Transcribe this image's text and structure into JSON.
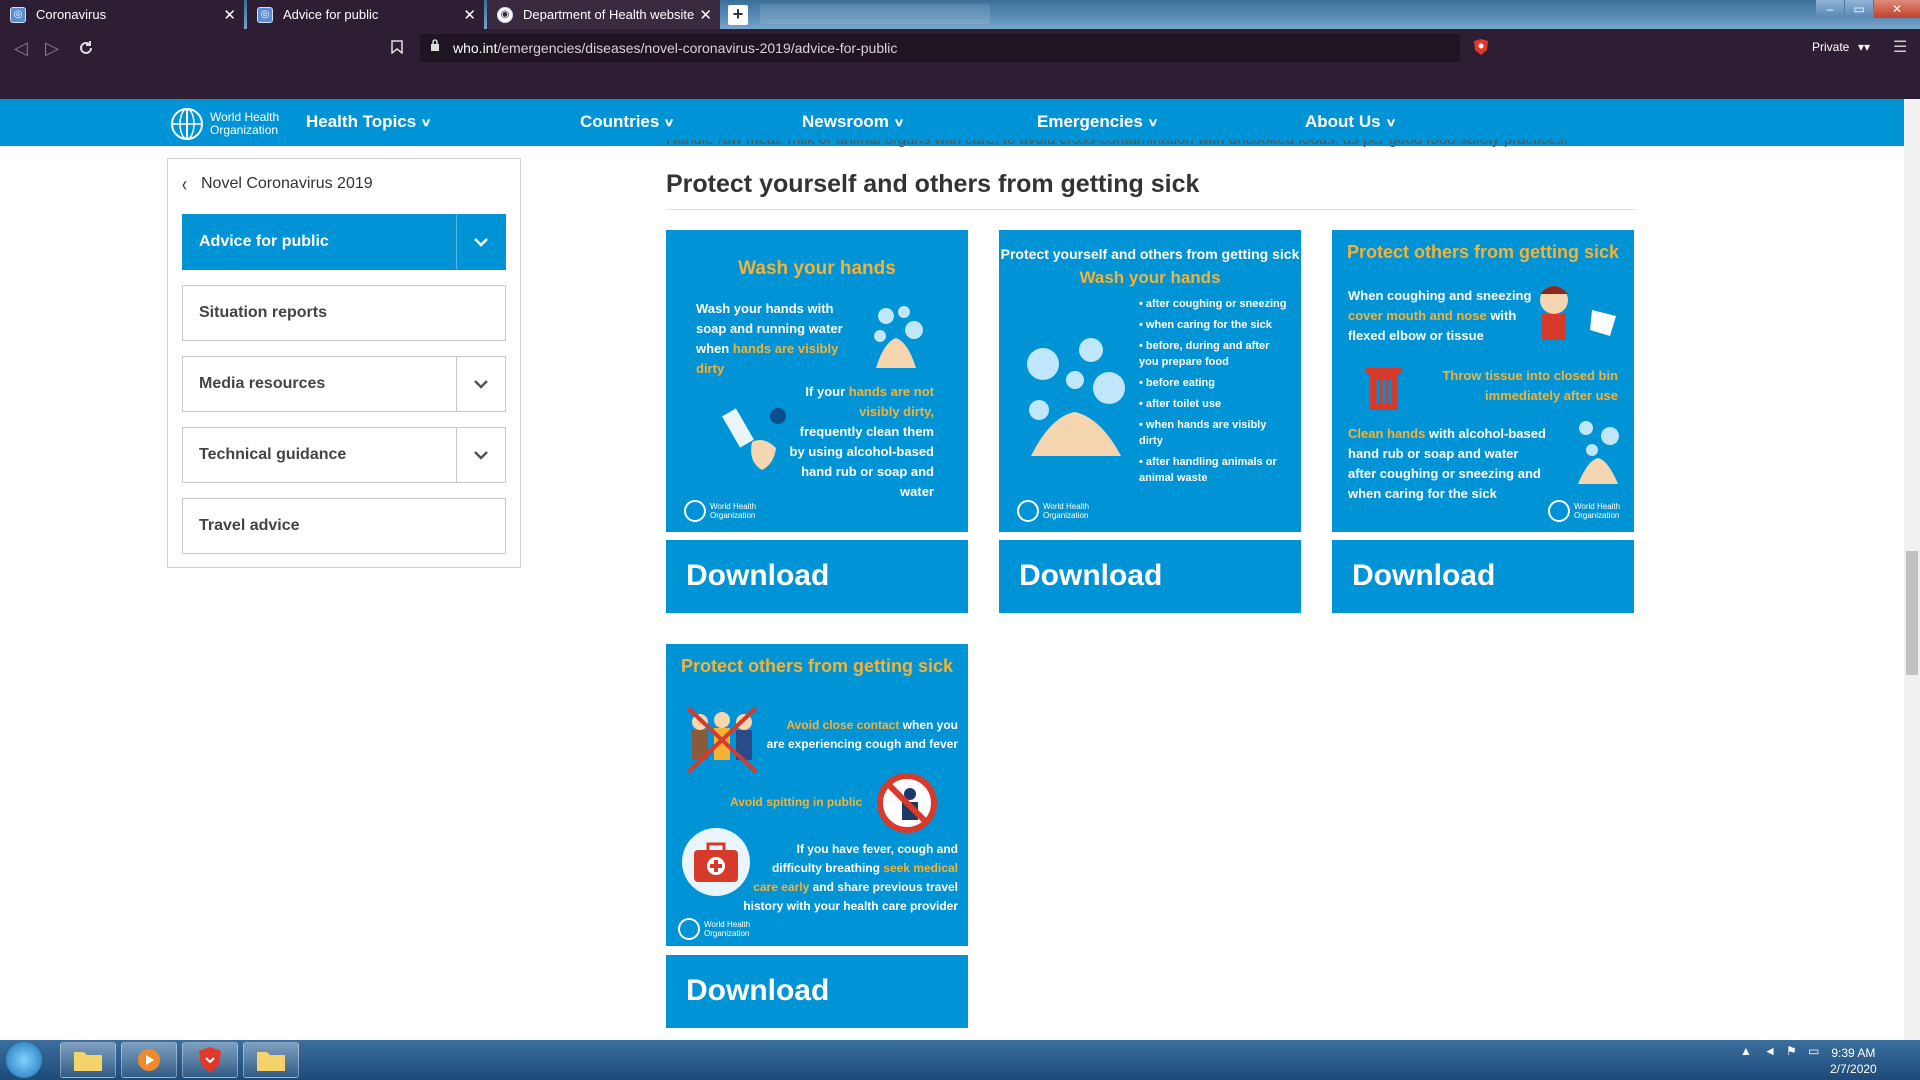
{
  "browser": {
    "tabs": [
      {
        "title": "Coronavirus"
      },
      {
        "title": "Advice for public"
      },
      {
        "title": "Department of Health website"
      }
    ],
    "url_host": "who.int",
    "url_path": "/emergencies/diseases/novel-coronavirus-2019/advice-for-public",
    "private_label": "Private"
  },
  "who_nav": {
    "logo_line1": "World Health",
    "logo_line2": "Organization",
    "items": [
      "Health Topics",
      "Countries",
      "Newsroom",
      "Emergencies",
      "About Us"
    ]
  },
  "page": {
    "cut_text": "Handle raw meat, milk or animal organs with care, to avoid cross-contamination with uncooked foods, as per good food safety practices.",
    "heading": "Protect yourself and others from getting sick"
  },
  "sidebar": {
    "back_label": "Novel Coronavirus 2019",
    "items": [
      {
        "label": "Advice for public"
      },
      {
        "label": "Situation reports"
      },
      {
        "label": "Media resources"
      },
      {
        "label": "Technical guidance"
      },
      {
        "label": "Travel advice"
      }
    ]
  },
  "cards": [
    {
      "title": "Wash your hands",
      "t1a": "Wash your hands with",
      "t1b": "soap and running water",
      "t1c": "when ",
      "t1c_y": "hands are visibly",
      "t1d_y": "dirty",
      "t2a": "If your ",
      "t2a_y": "hands are not",
      "t2b_y": "visibly dirty,",
      "t2c": "frequently clean them",
      "t2d": "by using alcohol-based",
      "t2e": "hand rub or soap and",
      "t2f": "water",
      "download": "Download"
    },
    {
      "subtitle": "Protect yourself and others from getting sick",
      "title": "Wash your hands",
      "bullets": [
        "after coughing or sneezing",
        "when caring for the sick",
        "before, during and after you prepare food",
        "before eating",
        "after toilet use",
        "when hands are visibly dirty",
        "after handling animals or animal waste"
      ],
      "download": "Download"
    },
    {
      "title": "Protect others from getting sick",
      "t1a": "When coughing and sneezing",
      "t1b_y": "cover mouth and nose",
      "t1b": " with",
      "t1c": "flexed elbow or tissue",
      "t2a_y": "Throw tissue into closed bin",
      "t2b_y": "immediately after use",
      "t3a_y": "Clean hands",
      "t3a": " with alcohol-based",
      "t3b": "hand rub or soap and water",
      "t3c": "after coughing or sneezing and",
      "t3d": "when caring for the sick",
      "download": "Download"
    },
    {
      "title": "Protect others from getting sick",
      "t1a_y": "Avoid close contact",
      "t1a": " when you",
      "t1b": "are experiencing cough and fever",
      "t2_y": "Avoid spitting in public",
      "t3a": "If you have fever, cough and",
      "t3b": "difficulty breathing ",
      "t3b_y": "seek medical",
      "t3c_y": "care early",
      "t3c": " and share previous travel",
      "t3d": "history with your health care provider",
      "download": "Download"
    }
  ],
  "taskbar": {
    "time": "9:39 AM",
    "date": "2/7/2020"
  },
  "colors": {
    "who_blue": "#0093d5",
    "accent_yellow": "#f5b335",
    "browser_dark": "#2e1e33"
  }
}
